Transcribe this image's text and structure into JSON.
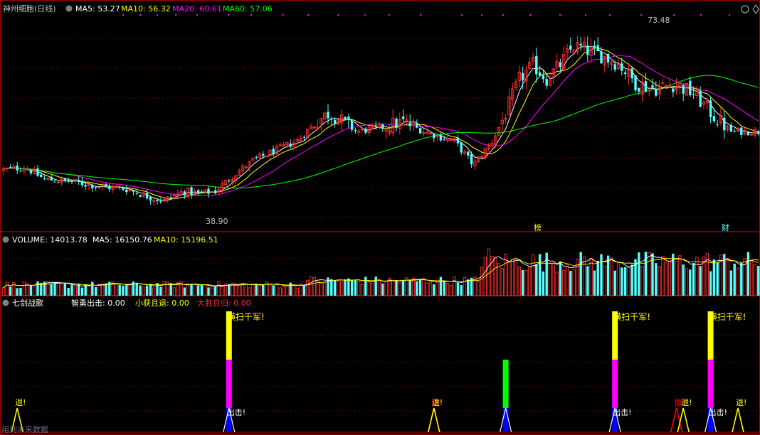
{
  "chart_data": [
    {
      "type": "candlestick",
      "title": "神州细胞(日线)",
      "indicators": [
        {
          "label": "MA5: 53.27",
          "color": "#ffffff"
        },
        {
          "label": "MA10: 56.32",
          "color": "#ffff00"
        },
        {
          "label": "MA20: 60.61",
          "color": "#ff00ff"
        },
        {
          "label": "MA60: 57.06",
          "color": "#00ff00"
        }
      ],
      "y_range": [
        36,
        78
      ],
      "high_label": "73.48",
      "low_label": "38.90",
      "markers": [
        "榜",
        "财"
      ],
      "series_colors": {
        "up": "#ff3030",
        "down": "#54ffff",
        "ma5": "#ffffff",
        "ma10": "#ffff00",
        "ma20": "#ff00ff",
        "ma60": "#00ff00"
      }
    },
    {
      "type": "bar",
      "title": "VOLUME: 14013.78",
      "indicators": [
        {
          "label": "MA5: 16150.76",
          "color": "#ffffff"
        },
        {
          "label": "MA10: 15196.51",
          "color": "#ffff00"
        }
      ]
    },
    {
      "type": "signal",
      "title": "七剑战歌",
      "indicators": [
        {
          "label": "智勇出击: 0.00",
          "color": "#ffffff"
        },
        {
          "label": "小获且退: 0.00",
          "color": "#ffff00"
        },
        {
          "label": "大胜且归: 0.00",
          "color": "#ff3030"
        }
      ],
      "signals": [
        {
          "bar": 4,
          "kind": "tri",
          "color": "#ffff00",
          "text": "退!",
          "text_color": "#ffff00"
        },
        {
          "bar": 66,
          "kind": "stack",
          "segments": [
            "#0000ff",
            "#ff00ff",
            "#ffff00"
          ],
          "text": "横扫千军!",
          "text2": "出击!"
        },
        {
          "bar": 126,
          "kind": "tri",
          "color": "#ff0000",
          "text": "撤!",
          "text_color": "#ff0000"
        },
        {
          "bar": 126,
          "kind": "tri",
          "color": "#ffff00",
          "text": "退!",
          "text_color": "#ffff00"
        },
        {
          "bar": 147,
          "kind": "stack",
          "segments": [
            "#0000ff",
            "#00ff00"
          ]
        },
        {
          "bar": 179,
          "kind": "stack",
          "segments": [
            "#0000ff",
            "#ff00ff",
            "#ffff00"
          ],
          "text": "横扫千军!",
          "text2": "出击!"
        },
        {
          "bar": 197,
          "kind": "tri",
          "color": "#ff0000",
          "text": "撤!",
          "text_color": "#ff0000"
        },
        {
          "bar": 199,
          "kind": "tri",
          "color": "#ffff00",
          "text": "退!",
          "text_color": "#ffff00"
        },
        {
          "bar": 207,
          "kind": "stack",
          "segments": [
            "#0000ff",
            "#ff00ff",
            "#ffff00"
          ],
          "text": "横扫千军!",
          "text2": "出击!"
        },
        {
          "bar": 215,
          "kind": "tri",
          "color": "#ffff00",
          "text": "退!",
          "text_color": "#ffff00"
        }
      ],
      "watermark": "用到未来数据"
    }
  ]
}
